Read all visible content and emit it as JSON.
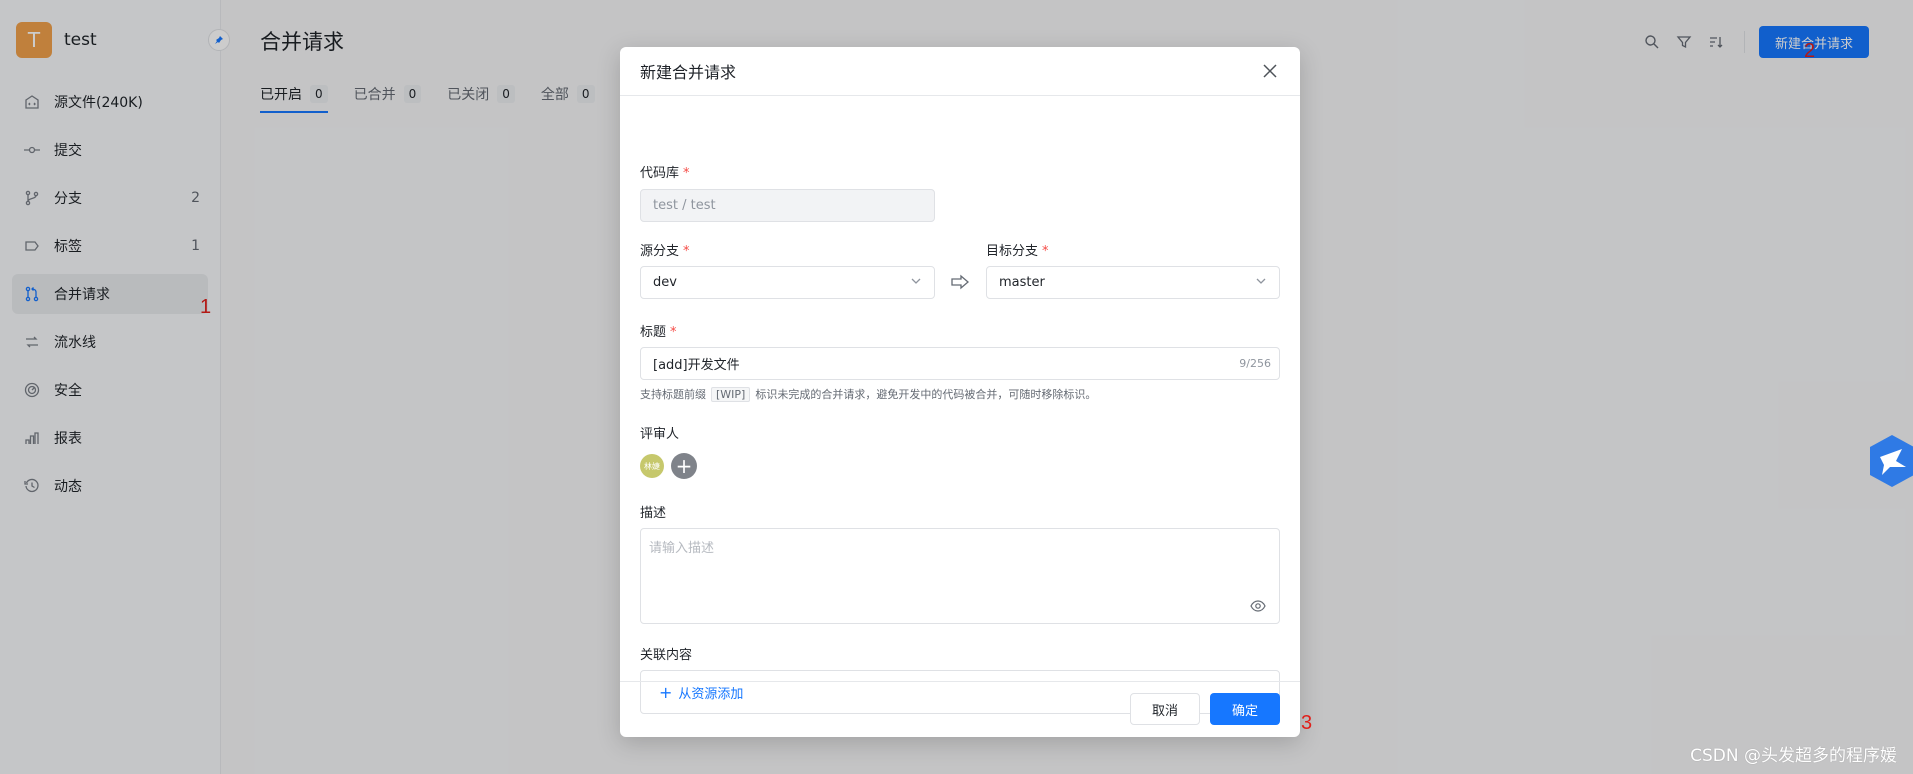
{
  "project": {
    "avatar_letter": "T",
    "name": "test"
  },
  "sidebar": {
    "items": [
      {
        "label": "源文件(240K)",
        "icon": "source-code-icon",
        "count": ""
      },
      {
        "label": "提交",
        "icon": "commit-icon",
        "count": ""
      },
      {
        "label": "分支",
        "icon": "branch-icon",
        "count": "2"
      },
      {
        "label": "标签",
        "icon": "tag-icon",
        "count": "1"
      },
      {
        "label": "合并请求",
        "icon": "merge-request-icon",
        "count": ""
      },
      {
        "label": "流水线",
        "icon": "pipeline-icon",
        "count": ""
      },
      {
        "label": "安全",
        "icon": "security-icon",
        "count": ""
      },
      {
        "label": "报表",
        "icon": "report-icon",
        "count": ""
      },
      {
        "label": "动态",
        "icon": "history-icon",
        "count": ""
      }
    ],
    "active_index": 4
  },
  "main": {
    "title": "合并请求",
    "tabs": [
      {
        "label": "已开启",
        "count": "0"
      },
      {
        "label": "已合并",
        "count": "0"
      },
      {
        "label": "已关闭",
        "count": "0"
      },
      {
        "label": "全部",
        "count": "0"
      }
    ],
    "new_button": "新建合并请求"
  },
  "annotations": {
    "a1": "1",
    "a2": "2",
    "a3": "3"
  },
  "modal": {
    "title": "新建合并请求",
    "repo_label": "代码库",
    "repo_value": "test / test",
    "source_label": "源分支",
    "source_value": "dev",
    "target_label": "目标分支",
    "target_value": "master",
    "title_label": "标题",
    "title_value": "[add]开发文件",
    "title_counter": "9/256",
    "hint_prefix": "支持标题前缀",
    "hint_tag": "[WIP]",
    "hint_suffix": "标识未完成的合并请求，避免开发中的代码被合并，可随时移除标识。",
    "reviewer_label": "评审人",
    "reviewer_avatar": "林婕",
    "desc_label": "描述",
    "desc_placeholder": "请输入描述",
    "related_label": "关联内容",
    "related_add": "从资源添加",
    "cancel": "取消",
    "ok": "确定"
  },
  "watermark": "CSDN @头发超多的程序媛",
  "colors": {
    "primary": "#1677ff",
    "required": "#f54a45",
    "annotation": "#e0201b"
  }
}
